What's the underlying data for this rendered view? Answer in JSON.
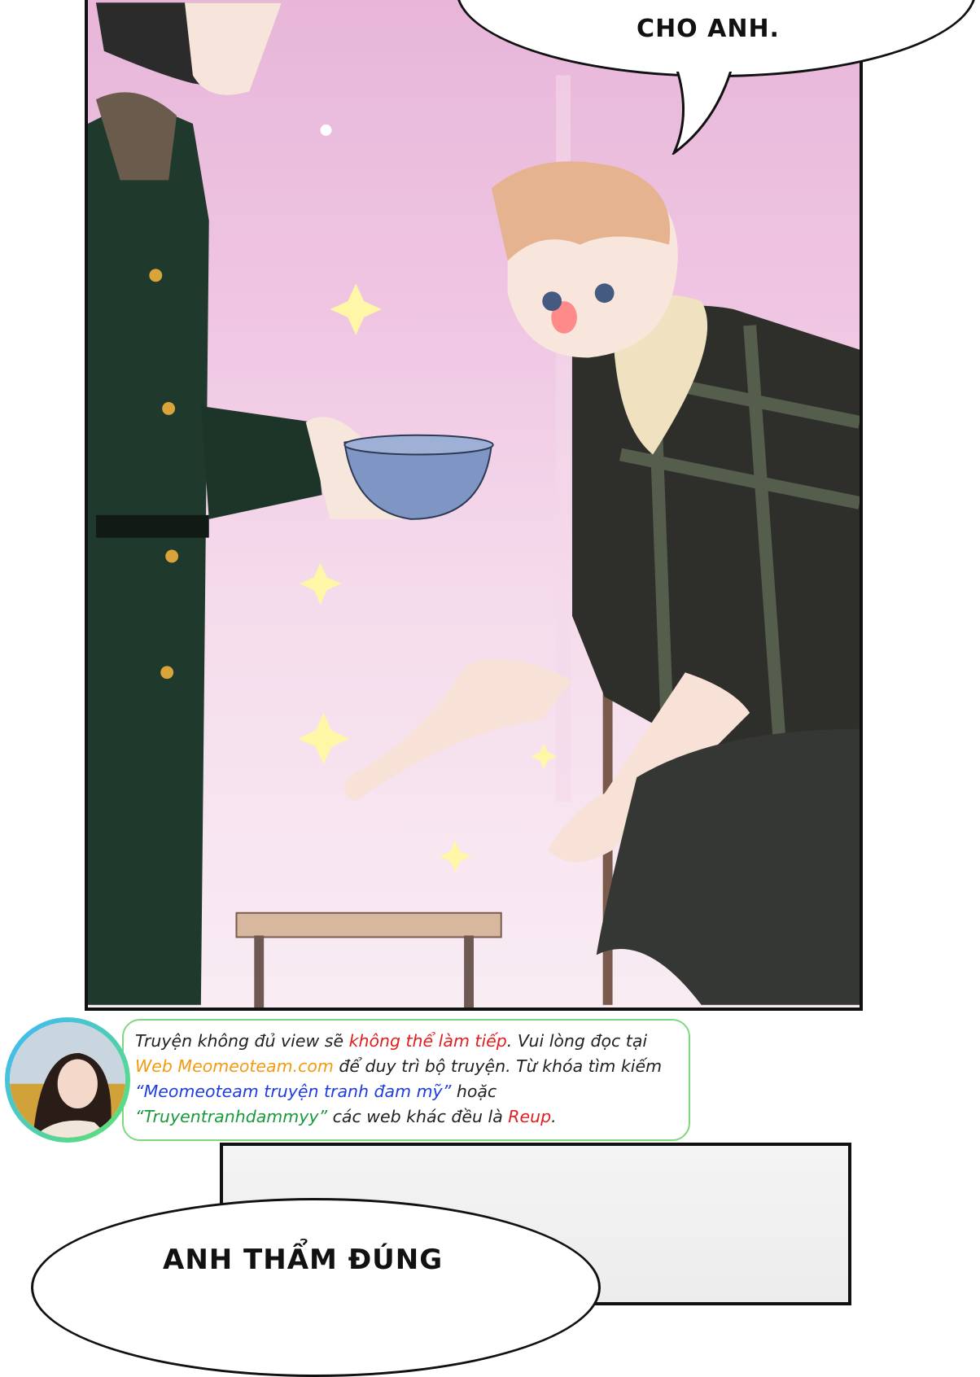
{
  "top_panel": {
    "speech_bubble_text": "CHO ANH."
  },
  "notice": {
    "segments": [
      {
        "text": "Truyện không đủ view sẽ ",
        "color": "default"
      },
      {
        "text": "không thể làm tiếp",
        "color": "red"
      },
      {
        "text": ". Vui lòng đọc tại ",
        "color": "default"
      },
      {
        "text": "Web Meomeoteam.com",
        "color": "orange"
      },
      {
        "text": " để duy trì bộ truyện. Từ khóa tìm kiếm ",
        "color": "default"
      },
      {
        "text": "“Meomeoteam truyện tranh đam mỹ”",
        "color": "blue"
      },
      {
        "text": " hoặc ",
        "color": "default"
      },
      {
        "text": "“Truyentranhdammyy”",
        "color": "green"
      },
      {
        "text": " các web khác đều là ",
        "color": "default"
      },
      {
        "text": "Reup",
        "color": "red"
      },
      {
        "text": ".",
        "color": "default"
      }
    ]
  },
  "bottom_panel": {
    "speech_bubble_text": "ANH THẨM ĐÚNG"
  },
  "colors": {
    "panel_pink": "#efc5e2",
    "coat_green": "#1f3a2c",
    "bowl_blue": "#7f95c4",
    "hair_blond": "#e6b391",
    "notice_border": "#7fd77f"
  }
}
